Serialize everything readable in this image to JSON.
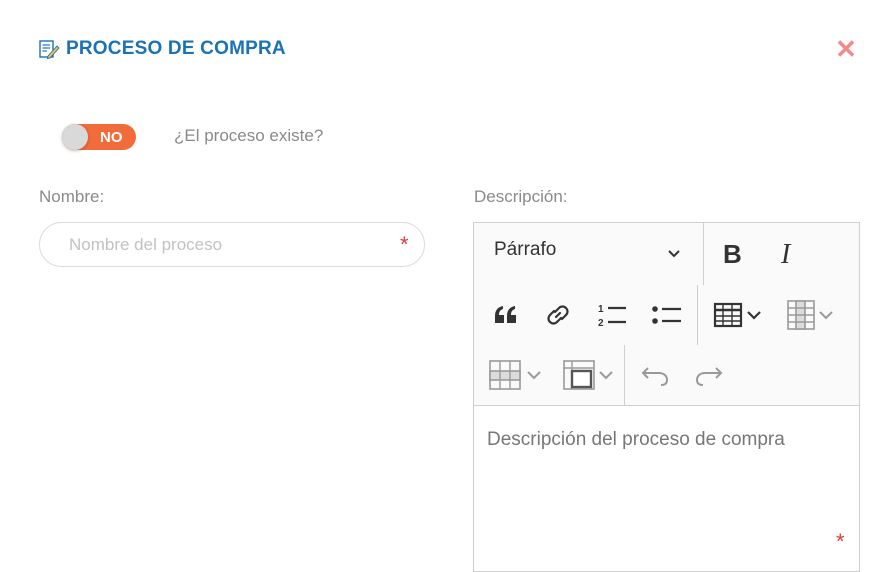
{
  "modal": {
    "title": "PROCESO DE COMPRA",
    "title_icon": "edit-document-icon",
    "close_icon": "close-icon",
    "close_symbol": "✕"
  },
  "toggle": {
    "state_label": "NO",
    "question": "¿El proceso existe?",
    "checked": false
  },
  "name_field": {
    "label": "Nombre:",
    "placeholder": "Nombre del proceso",
    "value": "",
    "required_mark": "*"
  },
  "description_field": {
    "label": "Descripción:",
    "required_mark": "*",
    "editor": {
      "heading_select": "Párrafo",
      "toolbar_icons": [
        "bold-icon",
        "italic-icon",
        "blockquote-icon",
        "link-icon",
        "numbered-list-icon",
        "bulleted-list-icon",
        "insert-table-icon",
        "table-column-icon",
        "table-row-icon",
        "merge-cells-icon",
        "undo-icon",
        "redo-icon"
      ],
      "placeholder": "Descripción del proceso de compra"
    }
  },
  "colors": {
    "title": "#1a73b5",
    "toggle_off": "#f26b3a",
    "close": "#f08a8a",
    "required": "#e53935"
  }
}
